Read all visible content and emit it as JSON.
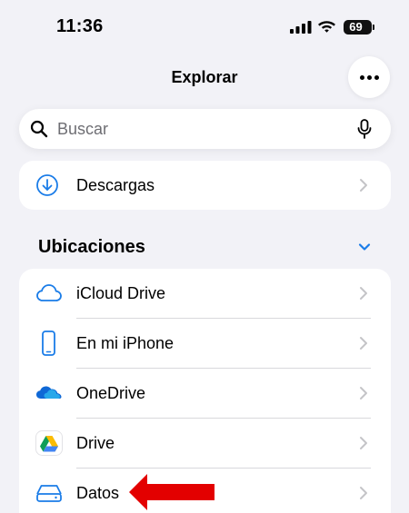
{
  "status": {
    "time": "11:36",
    "battery": "69"
  },
  "nav": {
    "title": "Explorar"
  },
  "search": {
    "placeholder": "Buscar"
  },
  "quick": {
    "downloads_label": "Descargas"
  },
  "locations": {
    "title": "Ubicaciones",
    "items": [
      {
        "label": "iCloud Drive",
        "icon": "icloud-icon"
      },
      {
        "label": "En mi iPhone",
        "icon": "iphone-icon"
      },
      {
        "label": "OneDrive",
        "icon": "onedrive-icon"
      },
      {
        "label": "Drive",
        "icon": "google-drive-icon"
      },
      {
        "label": "Datos",
        "icon": "drive-disk-icon"
      }
    ]
  },
  "colors": {
    "accent": "#1a7ce8",
    "background": "#f2f2f7",
    "arrow": "#e30000"
  }
}
